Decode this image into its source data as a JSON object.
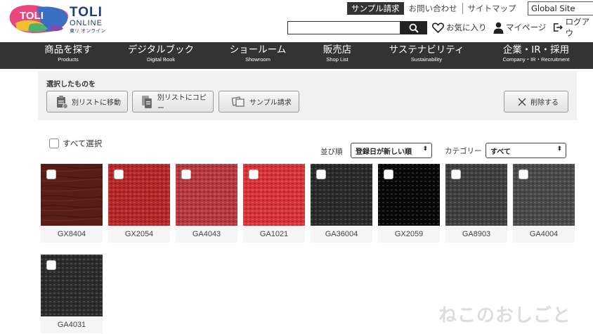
{
  "logo": {
    "badge": "TOLI",
    "main": "TOLI",
    "sub": "ONLINE",
    "sub2": "東リ オンライン"
  },
  "toplinks": {
    "sample_request": "サンプル請求",
    "contact": "お問い合わせ",
    "sitemap": "サイトマップ",
    "global_site": "Global Site"
  },
  "header": {
    "favorites": "お気に入り",
    "mypage": "マイページ",
    "logout": "ログアウ"
  },
  "nav": [
    {
      "jp": "商品を探す",
      "en": "Products"
    },
    {
      "jp": "デジタルブック",
      "en": "Digital Book"
    },
    {
      "jp": "ショールーム",
      "en": "Showroom"
    },
    {
      "jp": "販売店",
      "en": "Shop List"
    },
    {
      "jp": "サステナビリティ",
      "en": "Sustainability"
    },
    {
      "jp": "企業・IR・採用",
      "en": "Company・IR・Recruitment"
    }
  ],
  "selection": {
    "title": "選択したものを",
    "move": "別リストに移動",
    "copy": "別リストにコピー",
    "sample": "サンプル請求",
    "delete": "削除する"
  },
  "filters": {
    "select_all": "すべて選択",
    "sort_label": "並び順",
    "sort_value": "登録日が新しい順",
    "category_label": "カテゴリー",
    "category_value": "すべて"
  },
  "products": [
    {
      "code": "GX8404",
      "color": "#5a1c18"
    },
    {
      "code": "GX2054",
      "color": "#b8282a"
    },
    {
      "code": "GA4043",
      "color": "#b83a3e"
    },
    {
      "code": "GA1021",
      "color": "#d8343a"
    },
    {
      "code": "GA36004",
      "color": "#2a2a2a"
    },
    {
      "code": "GX2059",
      "color": "#080808"
    },
    {
      "code": "GA8903",
      "color": "#404040"
    },
    {
      "code": "GA4004",
      "color": "#4a4a4a"
    },
    {
      "code": "GA4031",
      "color": "#2c2c2c"
    }
  ],
  "watermark": "ねこのおしごと"
}
